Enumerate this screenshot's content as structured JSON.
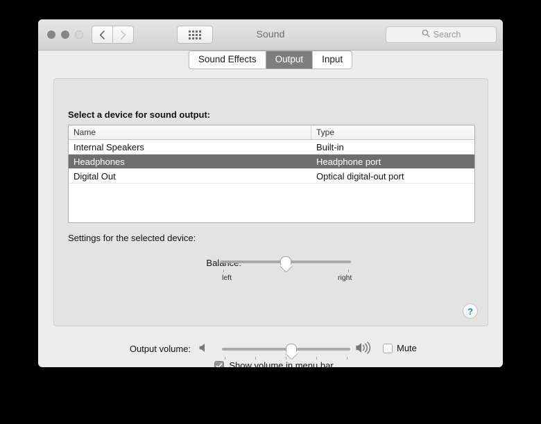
{
  "window": {
    "title": "Sound",
    "traffic_lights": [
      "close",
      "minimize",
      "zoom"
    ],
    "nav": {
      "back": "back-arrow",
      "forward": "forward-arrow"
    },
    "show_all_button": "show-all-grid",
    "search": {
      "placeholder": "Search",
      "value": "",
      "icon": "search-icon"
    }
  },
  "tabs": [
    {
      "label": "Sound Effects",
      "active": false
    },
    {
      "label": "Output",
      "active": true
    },
    {
      "label": "Input",
      "active": false
    }
  ],
  "output_pane": {
    "device_list_label": "Select a device for sound output:",
    "columns": [
      "Name",
      "Type"
    ],
    "devices": [
      {
        "name": "Internal Speakers",
        "type": "Built-in",
        "selected": false
      },
      {
        "name": "Headphones",
        "type": "Headphone port",
        "selected": true
      },
      {
        "name": "Digital Out",
        "type": "Optical digital-out port",
        "selected": false
      }
    ],
    "settings_label": "Settings for the selected device:",
    "balance": {
      "label": "Balance:",
      "left_label": "left",
      "right_label": "right",
      "value": 50,
      "min": 0,
      "max": 100
    },
    "help_button": "?"
  },
  "bottom": {
    "output_volume_label": "Output volume:",
    "volume": {
      "value": 54,
      "min": 0,
      "max": 100
    },
    "speaker_low_icon": "speaker-icon",
    "speaker_high_icon": "speaker-waves-icon",
    "mute": {
      "label": "Mute",
      "checked": false
    },
    "show_in_menu_bar": {
      "label": "Show volume in menu bar",
      "checked": true
    }
  },
  "colors": {
    "window_bg": "#ececec",
    "panel_bg": "#e3e3e3",
    "selection": "#6e6e6e",
    "accent_blue": "#1b84e8",
    "tab_active_bg": "#7d7d7d"
  }
}
